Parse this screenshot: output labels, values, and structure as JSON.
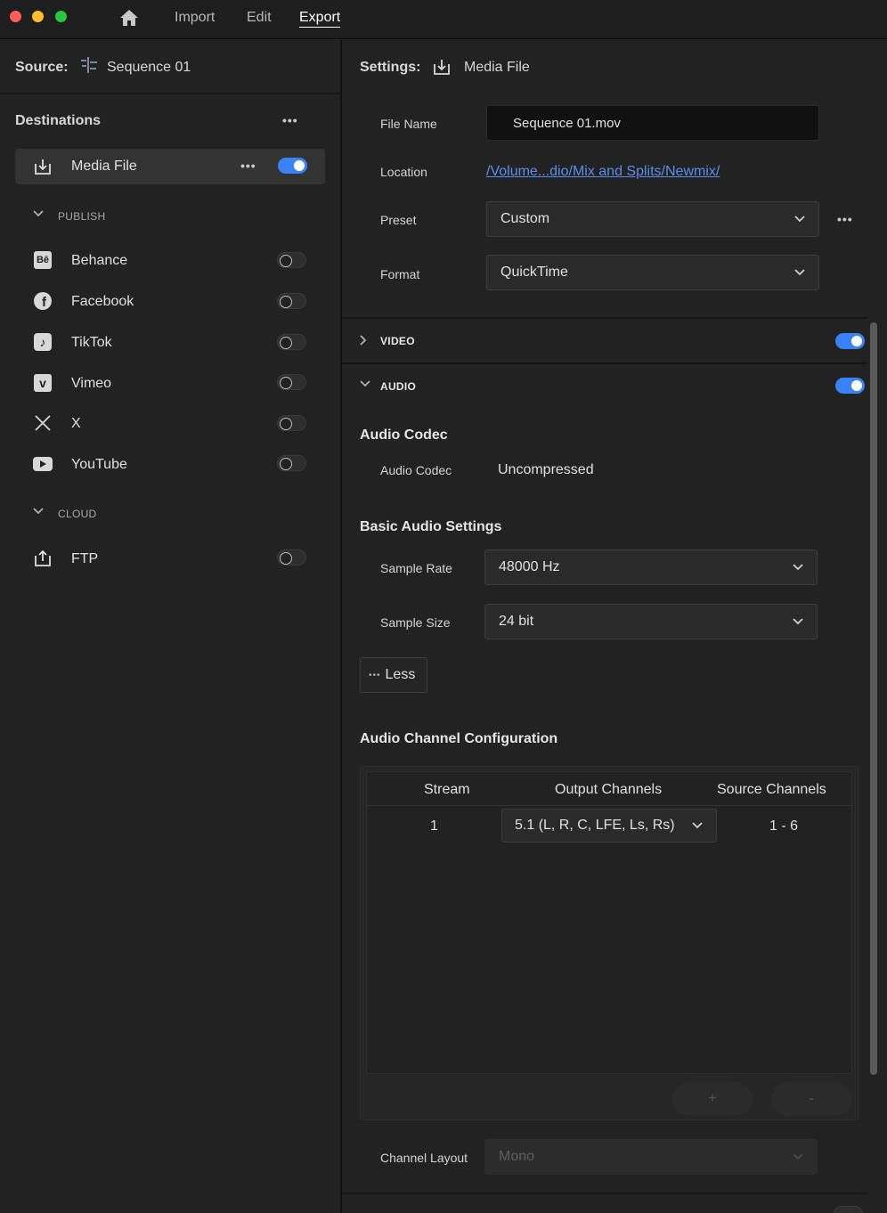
{
  "nav": {
    "import": "Import",
    "edit": "Edit",
    "export": "Export"
  },
  "source": {
    "label": "Source:",
    "value": "Sequence 01"
  },
  "destinations": {
    "title": "Destinations",
    "media_file": "Media File",
    "publish_label": "PUBLISH",
    "publish": [
      "Behance",
      "Facebook",
      "TikTok",
      "Vimeo",
      "X",
      "YouTube"
    ],
    "cloud_label": "CLOUD",
    "cloud": [
      "FTP"
    ]
  },
  "settings": {
    "label": "Settings:",
    "value": "Media File",
    "file_name_label": "File Name",
    "file_name": "Sequence 01.mov",
    "location_label": "Location",
    "location": "/Volume...dio/Mix and Splits/Newmix/",
    "preset_label": "Preset",
    "preset": "Custom",
    "format_label": "Format",
    "format": "QuickTime"
  },
  "video": {
    "label": "VIDEO",
    "enabled": true
  },
  "audio": {
    "label": "AUDIO",
    "enabled": true,
    "codec_section": "Audio Codec",
    "codec_label": "Audio Codec",
    "codec_value": "Uncompressed",
    "basic_section": "Basic Audio Settings",
    "sample_rate_label": "Sample Rate",
    "sample_rate": "48000 Hz",
    "sample_size_label": "Sample Size",
    "sample_size": "24 bit",
    "less_button": "Less",
    "channel_section": "Audio Channel Configuration",
    "table_headers": [
      "Stream",
      "Output Channels",
      "Source Channels"
    ],
    "rows": [
      {
        "stream": "1",
        "output": "5.1 (L, R, C, LFE, Ls, Rs)",
        "source": "1 - 6"
      }
    ],
    "add_button": "+",
    "remove_button": "-",
    "channel_layout_label": "Channel Layout",
    "channel_layout": "Mono"
  },
  "colors": {
    "accent": "#3b82f6",
    "link": "#5b8def"
  }
}
